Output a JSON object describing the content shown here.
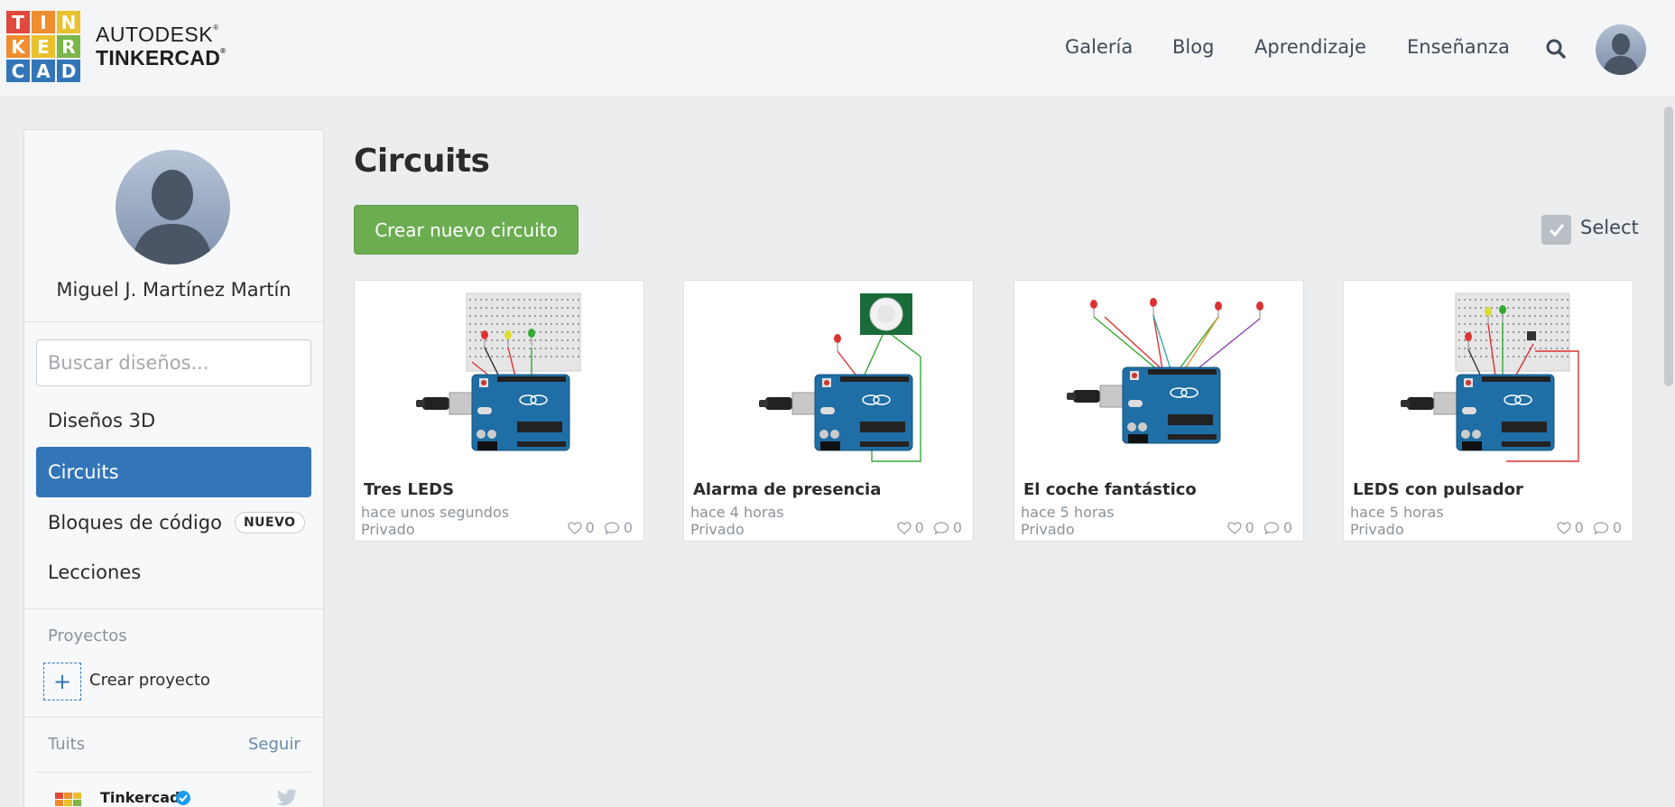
{
  "header": {
    "logo_letters": [
      "T",
      "I",
      "N",
      "K",
      "E",
      "R",
      "C",
      "A",
      "D"
    ],
    "logo_colors": [
      "#e1493c",
      "#ef8d2f",
      "#e9c12e",
      "#ef8d2f",
      "#e9c12e",
      "#7ab648",
      "#3376b8",
      "#3376b8",
      "#3376b8"
    ],
    "brand_top": "AUTODESK",
    "brand_bottom": "TINKERCAD",
    "nav": [
      "Galería",
      "Blog",
      "Aprendizaje",
      "Enseñanza"
    ]
  },
  "sidebar": {
    "user_name": "Miguel J. Martínez Martín",
    "search_placeholder": "Buscar diseños...",
    "items": [
      {
        "label": "Diseños 3D"
      },
      {
        "label": "Circuits"
      },
      {
        "label": "Bloques de código",
        "badge": "NUEVO"
      },
      {
        "label": "Lecciones"
      }
    ],
    "projects_label": "Proyectos",
    "create_project_label": "Crear proyecto",
    "tweets_label": "Tuits",
    "follow_label": "Seguir",
    "tweet_author": "Tinkercad"
  },
  "main": {
    "title": "Circuits",
    "create_button": "Crear nuevo circuito",
    "select_label": "Select",
    "cards": [
      {
        "title": "Tres LEDS",
        "time": "hace unos segundos",
        "privacy": "Privado",
        "likes": "0",
        "comments": "0"
      },
      {
        "title": "Alarma de presencia",
        "time": "hace 4 horas",
        "privacy": "Privado",
        "likes": "0",
        "comments": "0"
      },
      {
        "title": "El coche fantástico",
        "time": "hace 5 horas",
        "privacy": "Privado",
        "likes": "0",
        "comments": "0"
      },
      {
        "title": "LEDS con pulsador",
        "time": "hace 5 horas",
        "privacy": "Privado",
        "likes": "0",
        "comments": "0"
      }
    ]
  },
  "colors": {
    "accent_blue": "#3376b8",
    "create_green": "#6cad52",
    "header_bg": "#f4f5f6",
    "page_bg": "#ebedef"
  }
}
